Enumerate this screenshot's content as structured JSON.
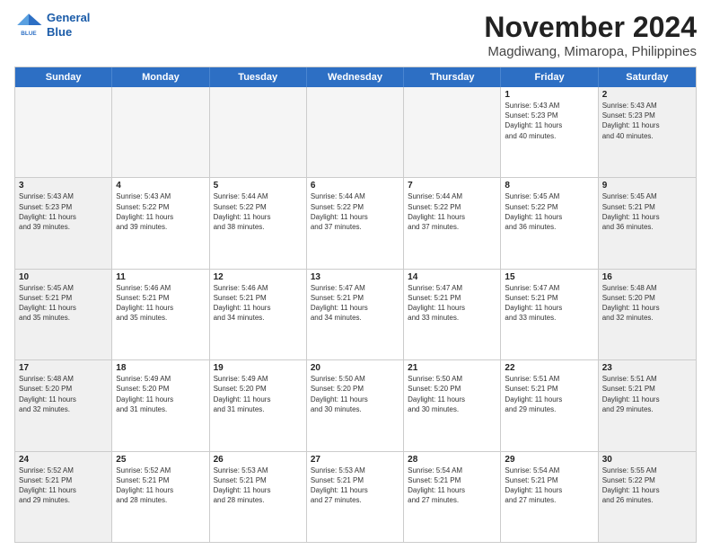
{
  "logo": {
    "line1": "General",
    "line2": "Blue"
  },
  "title": "November 2024",
  "location": "Magdiwang, Mimaropa, Philippines",
  "days_of_week": [
    "Sunday",
    "Monday",
    "Tuesday",
    "Wednesday",
    "Thursday",
    "Friday",
    "Saturday"
  ],
  "weeks": [
    [
      {
        "day": "",
        "info": ""
      },
      {
        "day": "",
        "info": ""
      },
      {
        "day": "",
        "info": ""
      },
      {
        "day": "",
        "info": ""
      },
      {
        "day": "",
        "info": ""
      },
      {
        "day": "1",
        "info": "Sunrise: 5:43 AM\nSunset: 5:23 PM\nDaylight: 11 hours\nand 40 minutes."
      },
      {
        "day": "2",
        "info": "Sunrise: 5:43 AM\nSunset: 5:23 PM\nDaylight: 11 hours\nand 40 minutes."
      }
    ],
    [
      {
        "day": "3",
        "info": "Sunrise: 5:43 AM\nSunset: 5:23 PM\nDaylight: 11 hours\nand 39 minutes."
      },
      {
        "day": "4",
        "info": "Sunrise: 5:43 AM\nSunset: 5:22 PM\nDaylight: 11 hours\nand 39 minutes."
      },
      {
        "day": "5",
        "info": "Sunrise: 5:44 AM\nSunset: 5:22 PM\nDaylight: 11 hours\nand 38 minutes."
      },
      {
        "day": "6",
        "info": "Sunrise: 5:44 AM\nSunset: 5:22 PM\nDaylight: 11 hours\nand 37 minutes."
      },
      {
        "day": "7",
        "info": "Sunrise: 5:44 AM\nSunset: 5:22 PM\nDaylight: 11 hours\nand 37 minutes."
      },
      {
        "day": "8",
        "info": "Sunrise: 5:45 AM\nSunset: 5:22 PM\nDaylight: 11 hours\nand 36 minutes."
      },
      {
        "day": "9",
        "info": "Sunrise: 5:45 AM\nSunset: 5:21 PM\nDaylight: 11 hours\nand 36 minutes."
      }
    ],
    [
      {
        "day": "10",
        "info": "Sunrise: 5:45 AM\nSunset: 5:21 PM\nDaylight: 11 hours\nand 35 minutes."
      },
      {
        "day": "11",
        "info": "Sunrise: 5:46 AM\nSunset: 5:21 PM\nDaylight: 11 hours\nand 35 minutes."
      },
      {
        "day": "12",
        "info": "Sunrise: 5:46 AM\nSunset: 5:21 PM\nDaylight: 11 hours\nand 34 minutes."
      },
      {
        "day": "13",
        "info": "Sunrise: 5:47 AM\nSunset: 5:21 PM\nDaylight: 11 hours\nand 34 minutes."
      },
      {
        "day": "14",
        "info": "Sunrise: 5:47 AM\nSunset: 5:21 PM\nDaylight: 11 hours\nand 33 minutes."
      },
      {
        "day": "15",
        "info": "Sunrise: 5:47 AM\nSunset: 5:21 PM\nDaylight: 11 hours\nand 33 minutes."
      },
      {
        "day": "16",
        "info": "Sunrise: 5:48 AM\nSunset: 5:20 PM\nDaylight: 11 hours\nand 32 minutes."
      }
    ],
    [
      {
        "day": "17",
        "info": "Sunrise: 5:48 AM\nSunset: 5:20 PM\nDaylight: 11 hours\nand 32 minutes."
      },
      {
        "day": "18",
        "info": "Sunrise: 5:49 AM\nSunset: 5:20 PM\nDaylight: 11 hours\nand 31 minutes."
      },
      {
        "day": "19",
        "info": "Sunrise: 5:49 AM\nSunset: 5:20 PM\nDaylight: 11 hours\nand 31 minutes."
      },
      {
        "day": "20",
        "info": "Sunrise: 5:50 AM\nSunset: 5:20 PM\nDaylight: 11 hours\nand 30 minutes."
      },
      {
        "day": "21",
        "info": "Sunrise: 5:50 AM\nSunset: 5:20 PM\nDaylight: 11 hours\nand 30 minutes."
      },
      {
        "day": "22",
        "info": "Sunrise: 5:51 AM\nSunset: 5:21 PM\nDaylight: 11 hours\nand 29 minutes."
      },
      {
        "day": "23",
        "info": "Sunrise: 5:51 AM\nSunset: 5:21 PM\nDaylight: 11 hours\nand 29 minutes."
      }
    ],
    [
      {
        "day": "24",
        "info": "Sunrise: 5:52 AM\nSunset: 5:21 PM\nDaylight: 11 hours\nand 29 minutes."
      },
      {
        "day": "25",
        "info": "Sunrise: 5:52 AM\nSunset: 5:21 PM\nDaylight: 11 hours\nand 28 minutes."
      },
      {
        "day": "26",
        "info": "Sunrise: 5:53 AM\nSunset: 5:21 PM\nDaylight: 11 hours\nand 28 minutes."
      },
      {
        "day": "27",
        "info": "Sunrise: 5:53 AM\nSunset: 5:21 PM\nDaylight: 11 hours\nand 27 minutes."
      },
      {
        "day": "28",
        "info": "Sunrise: 5:54 AM\nSunset: 5:21 PM\nDaylight: 11 hours\nand 27 minutes."
      },
      {
        "day": "29",
        "info": "Sunrise: 5:54 AM\nSunset: 5:21 PM\nDaylight: 11 hours\nand 27 minutes."
      },
      {
        "day": "30",
        "info": "Sunrise: 5:55 AM\nSunset: 5:22 PM\nDaylight: 11 hours\nand 26 minutes."
      }
    ]
  ]
}
